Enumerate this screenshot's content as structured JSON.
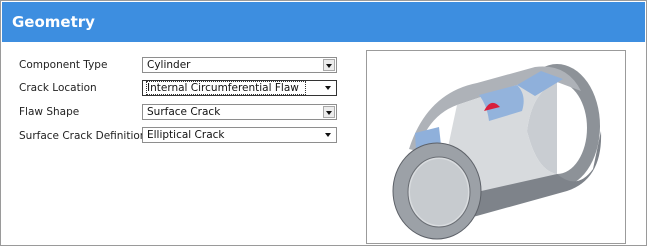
{
  "header": {
    "title": "Geometry"
  },
  "form": {
    "component_type": {
      "label": "Component Type",
      "value": "Cylinder"
    },
    "crack_location": {
      "label": "Crack Location",
      "value": "Internal Circumferential Flaw"
    },
    "flaw_shape": {
      "label": "Flaw Shape",
      "value": "Surface Crack"
    },
    "surface_crack_definition": {
      "label": "Surface Crack Definition",
      "value": "Elliptical Crack"
    }
  },
  "icons": {
    "dropdown": "chevron-down-icon"
  },
  "colors": {
    "header": "#3d8ee0",
    "cylinder_body": "#a9adb3",
    "cylinder_highlight": "#8fb0db",
    "crack": "#d81f3d"
  }
}
